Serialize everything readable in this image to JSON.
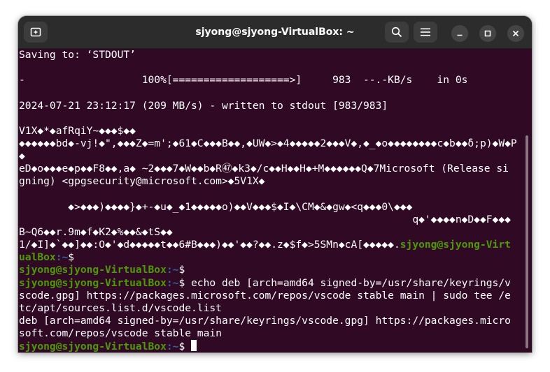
{
  "window": {
    "title": "sjyong@sjyong-VirtualBox: ~"
  },
  "icons": {
    "new_tab": "new-tab-icon",
    "search": "search-icon",
    "menu": "hamburger-menu-icon",
    "minimize": "minimize-icon",
    "maximize": "maximize-icon",
    "close": "close-icon"
  },
  "colors": {
    "terminal_bg": "#300a24",
    "prompt_user": "#4e9a06",
    "prompt_path": "#3465a4",
    "text": "#ffffff",
    "titlebar": "#2c2c2c"
  },
  "terminal": {
    "lines": [
      {
        "text": "Saving to: ‘STDOUT’"
      },
      {
        "text": ""
      },
      {
        "text": "-                   100%[===================>]     983  --.-KB/s    in 0s"
      },
      {
        "text": ""
      },
      {
        "text": "2024-07-21 23:12:17 (209 MB/s) - written to stdout [983/983]"
      },
      {
        "text": ""
      },
      {
        "text": "V1X◆*◆afRqiY~◆◆◆$◆◆"
      },
      {
        "text": "◆◆◆◆◆◆bd◆-vj!◆\",◆◆◆Z◆=m';◆61◆C◆◆◆B◆◆,◆UW◆>◆4◆◆◆◆◆2◆◆◆V◆,◆_◆o◆◆◆◆◆◆◆◆c◆b◆◆δ;p)◆W◆P"
      },
      {
        "text": "◆"
      },
      {
        "text": "eD◆o◆◆◆e◆p◆◆F8◆◆,a◆ ~2◆◆◆7◆W◆◆b◆R㊼◆k3◆/c◆◆H◆◆H◆+M◆◆◆◆◆◆Q◆7Microsoft (Release si"
      },
      {
        "text": "gning) <gpgsecurity@microsoft.com>◆5V1X◆"
      },
      {
        "text": ""
      },
      {
        "text": "        ◆>◆◆◆)◆◆◆◆}◆+-◆u◆_◆1◆◆◆◆◆o)◆◆V◆◆◆$◆I◆\\CM◆&◆gw◆<q◆◆◆0\\◆◆◆"
      },
      {
        "text": "                                                                q◆'◆◆◆◆n◆D◆◆F◆◆◆"
      },
      {
        "text": "B~Q6◆◆r.9m◆f◆K2◆%◆◆&◆tS◆◆"
      },
      {
        "text": "1/◆I]◆`◆◆]◆◆:O◆'◆d◆◆◆◆◆t◆◆6#B◆◆◆)◆◆'◆◆?◆◆.z◆$f◆>5SMn◆cA[◆◆◆◆◆.",
        "prompt_tail": "sjyong@sjyong-Virt"
      },
      {
        "prompt_head": "ualBox",
        "path": ":~",
        "text": "$"
      },
      {
        "prompt": "sjyong@sjyong-VirtualBox",
        "path": ":~",
        "text": "$"
      },
      {
        "prompt": "sjyong@sjyong-VirtualBox",
        "path": ":~",
        "text": "$ echo deb [arch=amd64 signed-by=/usr/share/keyrings/v"
      },
      {
        "text": "scode.gpg] https://packages.microsoft.com/repos/vscode stable main | sudo tee /e"
      },
      {
        "text": "tc/apt/sources.list.d/vscode.list"
      },
      {
        "text": "deb [arch=amd64 signed-by=/usr/share/keyrings/vscode.gpg] https://packages.micro"
      },
      {
        "text": "soft.com/repos/vscode stable main"
      },
      {
        "prompt": "sjyong@sjyong-VirtualBox",
        "path": ":~",
        "text": "$ ",
        "cursor": true
      }
    ]
  }
}
